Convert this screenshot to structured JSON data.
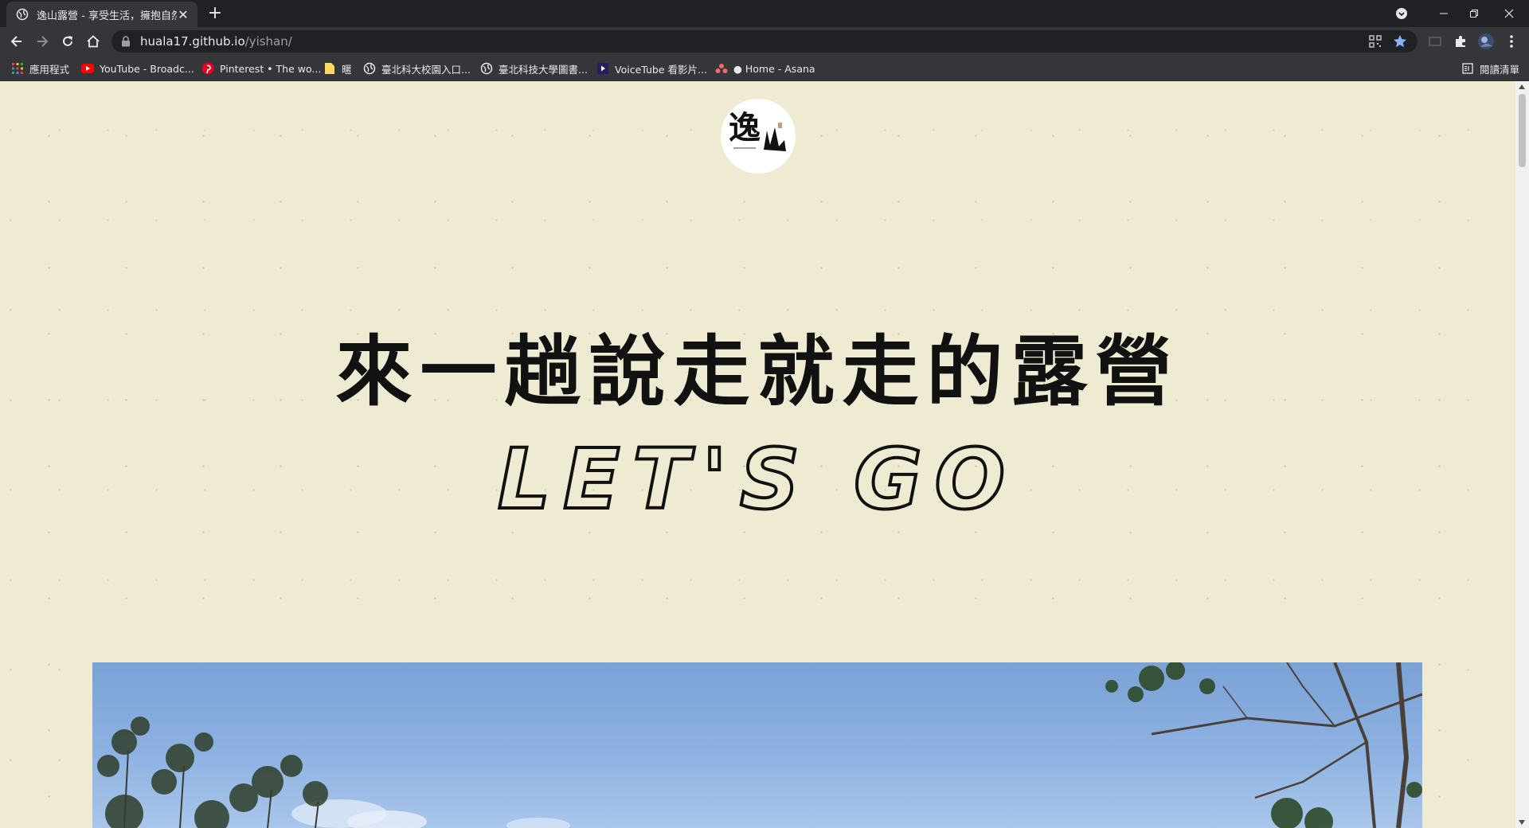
{
  "browser": {
    "tab": {
      "title": "逸山露營 - 享受生活，擁抱自然"
    },
    "address": {
      "host": "huala17.github.io",
      "path": "/yishan/"
    },
    "bookmarks": [
      {
        "label": "應用程式",
        "icon": "apps-grid-icon"
      },
      {
        "label": "YouTube - Broadc...",
        "icon": "youtube-icon"
      },
      {
        "label": "Pinterest • The wo...",
        "icon": "pinterest-icon"
      },
      {
        "label": "暱",
        "icon": "folder-icon"
      },
      {
        "label": "臺北科大校園入口...",
        "icon": "globe-icon"
      },
      {
        "label": "臺北科技大學圖書...",
        "icon": "globe-icon"
      },
      {
        "label": "VoiceTube 看影片...",
        "icon": "voicetube-icon"
      },
      {
        "label": "● Home - Asana",
        "icon": "asana-icon"
      }
    ],
    "reading_list": "閱讀清單"
  },
  "page": {
    "headline": "來一趟說走就走的露營",
    "subline": "LET'S GO",
    "logo_text": "逸山"
  }
}
